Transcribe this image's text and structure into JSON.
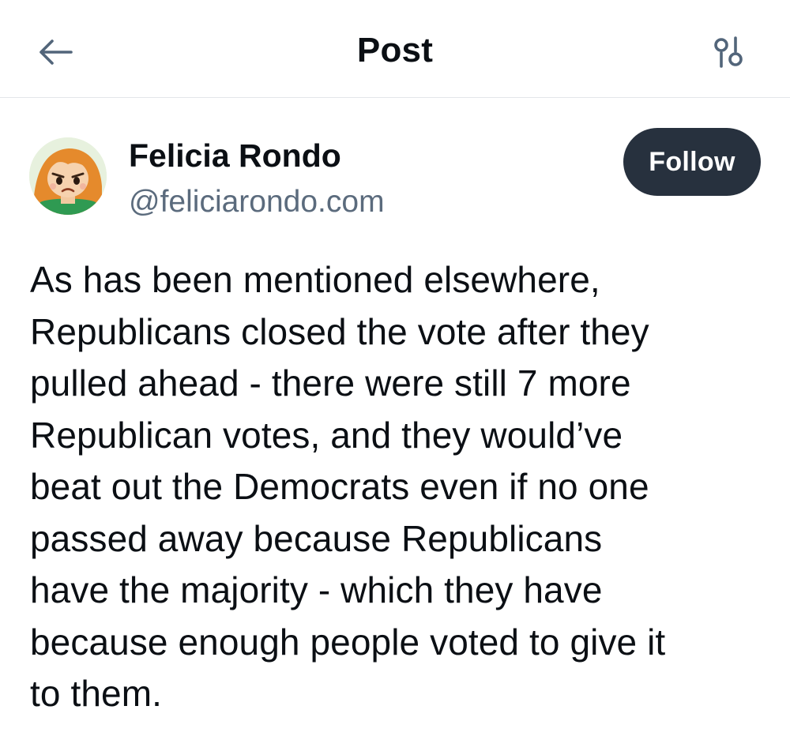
{
  "header": {
    "title": "Post",
    "back_icon": "arrow-left-icon",
    "options_icon": "sliders-icon"
  },
  "author": {
    "name": "Felicia Rondo",
    "handle": "@feliciarondo.com",
    "avatar_icon": "cartoon-avatar",
    "follow_label": "Follow"
  },
  "post": {
    "lines": [
      "As has been mentioned elsewhere,",
      "Republicans closed the vote after they",
      "pulled ahead - there were still 7 more",
      "Republican votes, and they would’ve",
      "beat out the Democrats even if no one",
      "passed away because Republicans",
      "have the majority - which they have",
      "because enough people voted to give it",
      "to them."
    ]
  },
  "colors": {
    "follow_bg": "#27313e",
    "handle_text": "#5b6b7d",
    "divider": "#e3e6ea",
    "icon": "#52657a"
  }
}
